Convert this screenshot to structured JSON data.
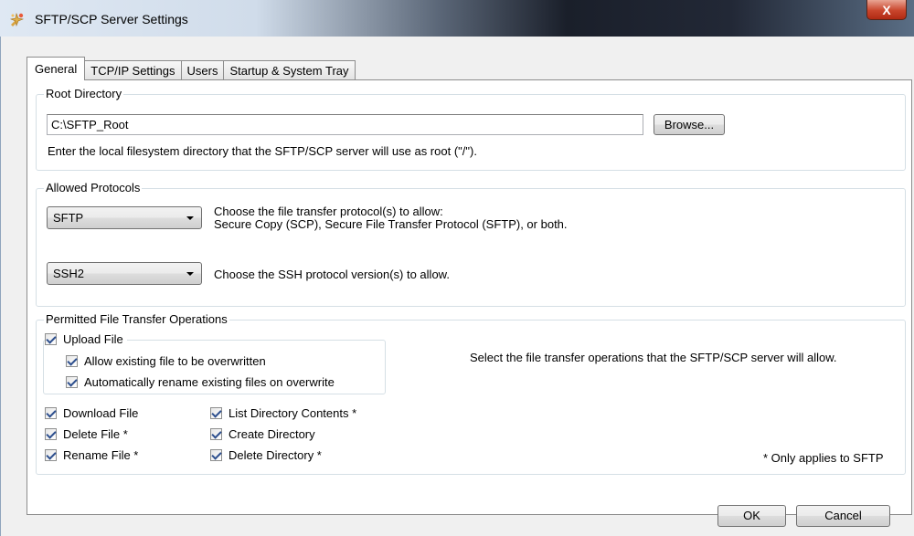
{
  "window": {
    "title": "SFTP/SCP Server Settings",
    "close_label": "X"
  },
  "tabs": [
    {
      "label": "General",
      "active": true
    },
    {
      "label": "TCP/IP Settings",
      "active": false
    },
    {
      "label": "Users",
      "active": false
    },
    {
      "label": "Startup & System Tray",
      "active": false
    }
  ],
  "root_directory": {
    "group_label": "Root Directory",
    "path_value": "C:\\SFTP_Root",
    "browse_label": "Browse...",
    "help_text": "Enter the local filesystem directory that the SFTP/SCP server will use as root (\"/\")."
  },
  "allowed_protocols": {
    "group_label": "Allowed Protocols",
    "transfer_protocol_value": "SFTP",
    "transfer_protocol_help_line1": "Choose the file transfer protocol(s) to allow:",
    "transfer_protocol_help_line2": "Secure Copy (SCP), Secure File Transfer Protocol (SFTP), or both.",
    "ssh_version_value": "SSH2",
    "ssh_version_help": "Choose the SSH protocol version(s) to allow."
  },
  "permitted_ops": {
    "group_label": "Permitted File Transfer Operations",
    "upload_label": "Upload File",
    "allow_overwrite_label": "Allow existing file to be overwritten",
    "auto_rename_label": "Automatically rename existing files on overwrite",
    "download_label": "Download File",
    "delete_file_label": "Delete File *",
    "rename_file_label": "Rename File *",
    "list_dir_label": "List Directory Contents *",
    "create_dir_label": "Create Directory",
    "delete_dir_label": "Delete Directory *",
    "help_text": "Select the file transfer operations that the SFTP/SCP server will allow.",
    "footnote": "* Only applies to SFTP"
  },
  "footer": {
    "ok_label": "OK",
    "cancel_label": "Cancel"
  },
  "colors": {
    "titlebar_dark": "#1a1f2a",
    "close_red": "#c9452c",
    "checkmark": "#2d4f8e"
  }
}
